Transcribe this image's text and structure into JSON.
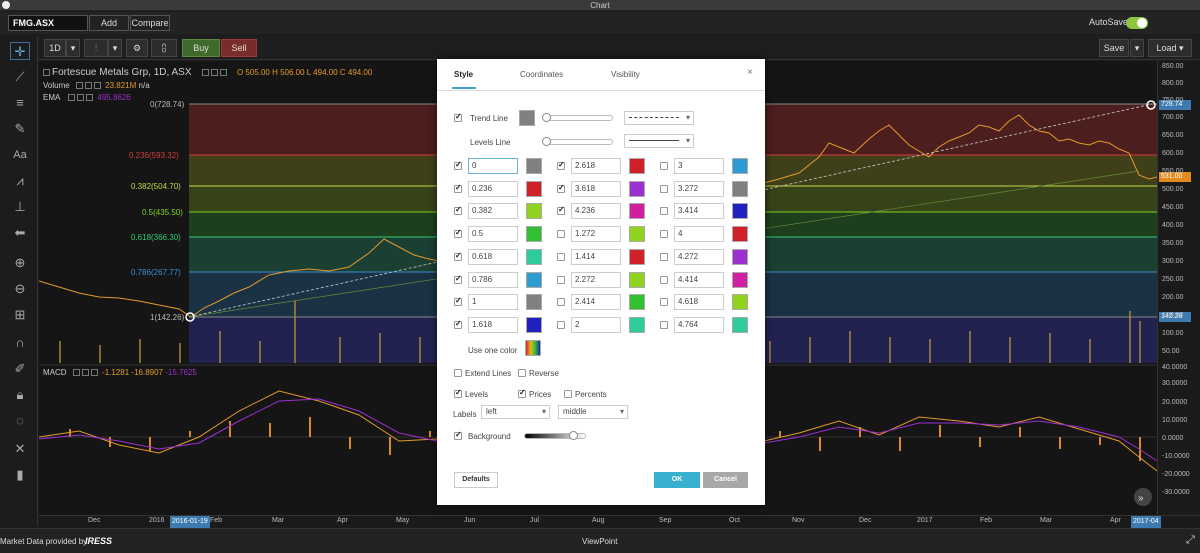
{
  "window": {
    "title": "Chart"
  },
  "topbar": {
    "symbol": "FMG.ASX",
    "add_label": "Add",
    "compare_label": "Compare",
    "autosave_label": "AutoSave"
  },
  "toolbar": {
    "interval": "1D",
    "buy_label": "Buy",
    "sell_label": "Sell",
    "save_label": "Save",
    "load_label": "Load"
  },
  "legend": {
    "title": "Fortescue Metals Grp, 1D, ASX",
    "ohlc": "O 505.00  H 506.00  L 494.00  C 494.00",
    "volume_label": "Volume",
    "volume_value": "23.821M",
    "volume_na": "n/a",
    "ema_label": "EMA",
    "ema_value": "495.8626",
    "macd_label": "MACD",
    "macd_v1": "-1.1281",
    "macd_v2": "-16.8907",
    "macd_v3": "-15.7625"
  },
  "fib_labels": [
    {
      "text": "0(728.74)",
      "color": "#bbbbbb"
    },
    {
      "text": "0.236(593.32)",
      "color": "#d33b3b"
    },
    {
      "text": "0.382(504.70)",
      "color": "#c6d64a"
    },
    {
      "text": "0.5(435.50)",
      "color": "#7ed321"
    },
    {
      "text": "0.618(366.30)",
      "color": "#2ecc71"
    },
    {
      "text": "0.786(267.77)",
      "color": "#3b8fd3"
    },
    {
      "text": "1(142.26)",
      "color": "#bbbbbb"
    }
  ],
  "yaxis": {
    "ticks": [
      "850.00",
      "800.00",
      "750.00",
      "700.00",
      "650.00",
      "600.00",
      "550.00",
      "500.00",
      "450.00",
      "400.00",
      "350.00",
      "300.00",
      "250.00",
      "200.00",
      "150.00",
      "100.00",
      "50.00",
      "40.0000",
      "30.0000",
      "20.0000",
      "10.0000",
      "0.0000",
      "-10.0000",
      "-20.0000",
      "-30.0000"
    ],
    "label_top": "728.74",
    "label_price": "531.00",
    "label_low": "142.26"
  },
  "xaxis": {
    "ticks": [
      "Dec",
      "2016",
      "Feb",
      "Mar",
      "Apr",
      "May",
      "Jun",
      "Jul",
      "Aug",
      "Sep",
      "Oct",
      "Nov",
      "Dec",
      "2017",
      "Feb",
      "Mar",
      "Apr"
    ],
    "highlight_left": "2016-01-19",
    "highlight_right": "2017-04"
  },
  "status": {
    "provider": "Market Data provided by",
    "brand": "IRESS",
    "center": "ViewPoint"
  },
  "dialog": {
    "tabs": [
      "Style",
      "Coordinates",
      "Visibility"
    ],
    "close": "×",
    "trend_line_label": "Trend Line",
    "levels_line_label": "Levels Line",
    "use_one_color_label": "Use one color",
    "extend_lines_label": "Extend Lines",
    "reverse_label": "Reverse",
    "levels_label": "Levels",
    "prices_label": "Prices",
    "percents_label": "Percents",
    "labels_label": "Labels",
    "labels_h": "left",
    "labels_v": "middle",
    "background_label": "Background",
    "defaults_label": "Defaults",
    "ok_label": "OK",
    "cancel_label": "Cancel",
    "levels": [
      [
        {
          "v": "0",
          "on": true,
          "c": "#808080"
        },
        {
          "v": "2.618",
          "on": true,
          "c": "#d0202a"
        },
        {
          "v": "3",
          "on": false,
          "c": "#2b9bd1"
        }
      ],
      [
        {
          "v": "0.236",
          "on": true,
          "c": "#d0202a"
        },
        {
          "v": "3.618",
          "on": true,
          "c": "#9b30d0"
        },
        {
          "v": "3.272",
          "on": false,
          "c": "#808080"
        }
      ],
      [
        {
          "v": "0.382",
          "on": true,
          "c": "#8fd31f"
        },
        {
          "v": "4.236",
          "on": true,
          "c": "#d020a0"
        },
        {
          "v": "3.414",
          "on": false,
          "c": "#2020c0"
        }
      ],
      [
        {
          "v": "0.5",
          "on": true,
          "c": "#30c030"
        },
        {
          "v": "1.272",
          "on": false,
          "c": "#8fd31f"
        },
        {
          "v": "4",
          "on": false,
          "c": "#d0202a"
        }
      ],
      [
        {
          "v": "0.618",
          "on": true,
          "c": "#2ecc9a"
        },
        {
          "v": "1.414",
          "on": false,
          "c": "#d0202a"
        },
        {
          "v": "4.272",
          "on": false,
          "c": "#9b30d0"
        }
      ],
      [
        {
          "v": "0.786",
          "on": true,
          "c": "#2b9bd1"
        },
        {
          "v": "2.272",
          "on": false,
          "c": "#8fd31f"
        },
        {
          "v": "4.414",
          "on": false,
          "c": "#d020a0"
        }
      ],
      [
        {
          "v": "1",
          "on": true,
          "c": "#808080"
        },
        {
          "v": "2.414",
          "on": false,
          "c": "#30c030"
        },
        {
          "v": "4.618",
          "on": false,
          "c": "#8fd31f"
        }
      ],
      [
        {
          "v": "1.618",
          "on": true,
          "c": "#2020c0"
        },
        {
          "v": "2",
          "on": false,
          "c": "#2ecc9a"
        },
        {
          "v": "4.764",
          "on": false,
          "c": "#2ecc9a"
        }
      ]
    ]
  }
}
